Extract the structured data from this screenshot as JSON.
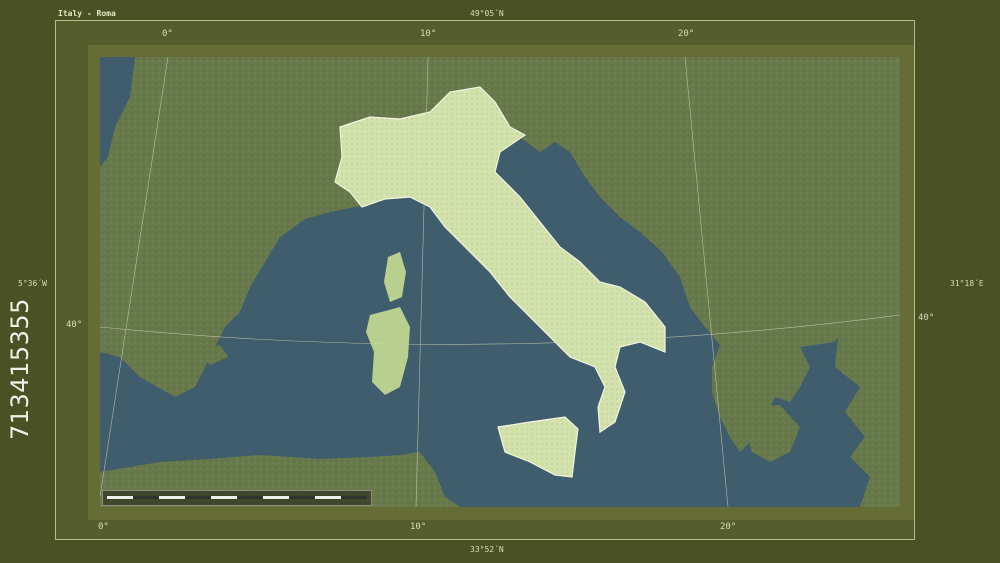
{
  "map": {
    "title": "Italy - Roma",
    "bounds": {
      "north": "49°05´N",
      "south": "33°52´N",
      "west": "5°36´W",
      "east": "31°18´E"
    },
    "graticule": {
      "top": [
        "0°",
        "10°",
        "20°"
      ],
      "bottom": [
        "0°",
        "10°",
        "20°"
      ],
      "left": "40°",
      "right": "40°"
    },
    "stock_id": "713415355",
    "colors": {
      "frame": "#4a5124",
      "sea": "#3f5d6c",
      "land_outside": "#6b7a4e",
      "highlight_land": "#cfe0a9"
    }
  }
}
